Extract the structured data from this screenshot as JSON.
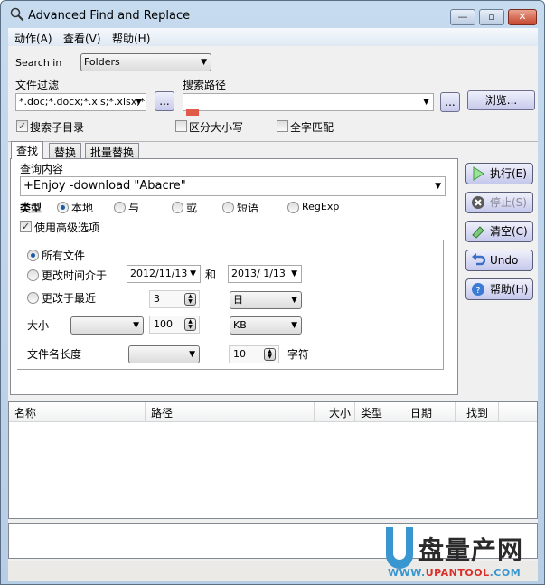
{
  "window": {
    "title": "Advanced Find and Replace",
    "controls": {
      "minimize": "—",
      "maximize": "▫",
      "close": "✕"
    }
  },
  "menu": [
    {
      "label": "动作(A)"
    },
    {
      "label": "查看(V)"
    },
    {
      "label": "帮助(H)"
    }
  ],
  "search_in": {
    "label": "Search in",
    "value": "Folders"
  },
  "file_filter": {
    "label": "文件过滤",
    "value": "*.doc;*.docx;*.xls;*.xlsx;*.h",
    "browse_label": "..."
  },
  "search_path": {
    "label": "搜索路径",
    "value": "",
    "ellipsis_label": "...",
    "browse_label": "浏览..."
  },
  "options": {
    "subdirs": {
      "label": "搜索子目录",
      "checked": true
    },
    "case_sensitive": {
      "label": "区分大小写",
      "checked": false
    },
    "whole_word": {
      "label": "全字匹配",
      "checked": false
    }
  },
  "tabs": [
    {
      "label": "查找",
      "active": true
    },
    {
      "label": "替换",
      "active": false
    },
    {
      "label": "批量替换",
      "active": false
    }
  ],
  "find": {
    "query_label": "查询内容",
    "query_value": "+Enjoy -download \"Abacre\"",
    "type_label": "类型",
    "types": [
      {
        "label": "本地",
        "selected": true
      },
      {
        "label": "与",
        "selected": false
      },
      {
        "label": "或",
        "selected": false
      },
      {
        "label": "短语",
        "selected": false
      },
      {
        "label": "RegExp",
        "selected": false
      }
    ],
    "advanced_label": "使用高级选项",
    "advanced_checked": true
  },
  "advanced": {
    "all_files": {
      "label": "所有文件",
      "selected": true
    },
    "modified_between": {
      "label": "更改时间介于",
      "selected": false,
      "from": "2012/11/13",
      "and_label": "和",
      "to": "2013/ 1/13"
    },
    "modified_recent": {
      "label": "更改于最近",
      "selected": false,
      "value": "3",
      "unit": "日"
    },
    "size": {
      "label": "大小",
      "operator": "",
      "value": "100",
      "unit": "KB"
    },
    "filename_length": {
      "label": "文件名长度",
      "operator": "",
      "value": "10",
      "unit_label": "字符"
    }
  },
  "side_buttons": [
    {
      "label": "执行(E)",
      "icon": "play-icon",
      "enabled": true
    },
    {
      "label": "停止(S)",
      "icon": "stop-icon",
      "enabled": false
    },
    {
      "label": "清空(C)",
      "icon": "eraser-icon",
      "enabled": true
    },
    {
      "label": "Undo",
      "icon": "undo-icon",
      "enabled": true
    },
    {
      "label": "帮助(H)",
      "icon": "help-icon",
      "enabled": true
    }
  ],
  "results": {
    "columns": [
      "名称",
      "路径",
      "大小",
      "类型",
      "日期",
      "找到"
    ],
    "rows": []
  },
  "watermark": {
    "cn": "盘量产网",
    "url_prefix": "WWW.",
    "url_main": "UPANTOOL",
    "url_suffix": ".COM"
  }
}
